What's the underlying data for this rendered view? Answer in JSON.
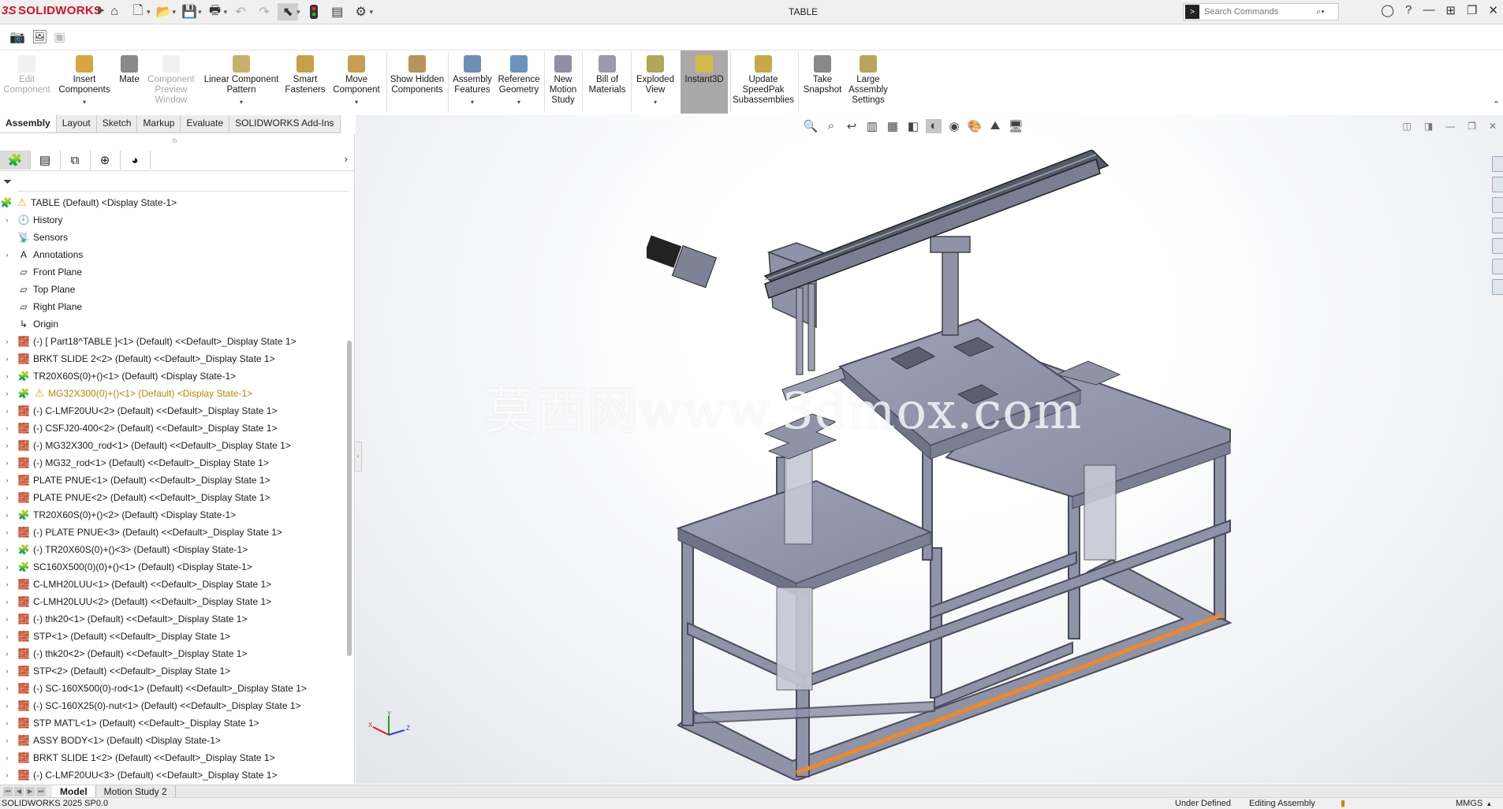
{
  "app": {
    "brand_prefix": "3S",
    "brand": "SOLIDWORKS",
    "doc_title": "TABLE"
  },
  "search": {
    "placeholder": "Search Commands"
  },
  "toolbar_icons": [
    "home-icon",
    "new-document-icon",
    "open-icon",
    "save-icon",
    "print-icon",
    "undo-icon",
    "redo-icon",
    "select-icon",
    "traffic-light-icon",
    "file-properties-icon",
    "options-gear-icon"
  ],
  "ribbon": {
    "buttons": [
      {
        "label": "Edit Component",
        "disabled": true
      },
      {
        "label": "Insert Components",
        "caret": true
      },
      {
        "label": "Mate"
      },
      {
        "label": "Component Preview Window",
        "disabled": true
      },
      {
        "label": "Linear Component Pattern",
        "caret": true
      },
      {
        "label": "Smart Fasteners"
      },
      {
        "label": "Move Component",
        "caret": true
      },
      {
        "label": "Show Hidden Components"
      },
      {
        "label": "Assembly Features",
        "caret": true
      },
      {
        "label": "Reference Geometry",
        "caret": true
      },
      {
        "label": "New Motion Study"
      },
      {
        "label": "Bill of Materials"
      },
      {
        "label": "Exploded View",
        "caret": true
      },
      {
        "label": "Instant3D",
        "active": true
      },
      {
        "label": "Update SpeedPak Subassemblies"
      },
      {
        "label": "Take Snapshot"
      },
      {
        "label": "Large Assembly Settings"
      }
    ]
  },
  "command_tabs": [
    "Assembly",
    "Layout",
    "Sketch",
    "Markup",
    "Evaluate",
    "SOLIDWORKS Add-Ins"
  ],
  "tree": {
    "root": "TABLE (Default) <Display State-1>",
    "items": [
      {
        "label": "History",
        "icon": "history-icon",
        "expandable": true
      },
      {
        "label": "Sensors",
        "icon": "sensors-icon"
      },
      {
        "label": "Annotations",
        "icon": "annotations-icon",
        "expandable": true
      },
      {
        "label": "Front Plane",
        "icon": "plane-icon"
      },
      {
        "label": "Top Plane",
        "icon": "plane-icon"
      },
      {
        "label": "Right Plane",
        "icon": "plane-icon"
      },
      {
        "label": "Origin",
        "icon": "origin-icon"
      },
      {
        "label": "(-) [ Part18^TABLE ]<1> (Default) <<Default>_Display State 1>",
        "icon": "part-icon",
        "expandable": true
      },
      {
        "label": "BRKT SLIDE 2<2> (Default) <<Default>_Display State 1>",
        "icon": "part-icon",
        "expandable": true
      },
      {
        "label": "TR20X60S(0)+()<1> (Default) <Display State-1>",
        "icon": "assembly-icon",
        "expandable": true
      },
      {
        "label": "MG32X300(0)+()<1> (Default) <Display State-1>",
        "icon": "assembly-icon",
        "expandable": true,
        "warning": true
      },
      {
        "label": "(-) C-LMF20UU<2> (Default) <<Default>_Display State 1>",
        "icon": "part-icon",
        "expandable": true
      },
      {
        "label": "(-) CSFJ20-400<2> (Default) <<Default>_Display State 1>",
        "icon": "part-icon",
        "expandable": true
      },
      {
        "label": "(-) MG32X300_rod<1> (Default) <<Default>_Display State 1>",
        "icon": "part-icon",
        "expandable": true
      },
      {
        "label": "(-) MG32_rod<1> (Default) <<Default>_Display State 1>",
        "icon": "part-icon",
        "expandable": true
      },
      {
        "label": "PLATE PNUE<1> (Default) <<Default>_Display State 1>",
        "icon": "part-icon",
        "expandable": true
      },
      {
        "label": "PLATE PNUE<2> (Default) <<Default>_Display State 1>",
        "icon": "part-icon",
        "expandable": true
      },
      {
        "label": "TR20X60S(0)+()<2> (Default) <Display State-1>",
        "icon": "assembly-icon",
        "expandable": true
      },
      {
        "label": "(-) PLATE PNUE<3> (Default) <<Default>_Display State 1>",
        "icon": "part-icon",
        "expandable": true
      },
      {
        "label": "(-) TR20X60S(0)+()<3> (Default) <Display State-1>",
        "icon": "assembly-icon",
        "expandable": true
      },
      {
        "label": "SC160X500(0)(0)+()<1> (Default) <Display State-1>",
        "icon": "assembly-icon",
        "expandable": true
      },
      {
        "label": "C-LMH20LUU<1> (Default) <<Default>_Display State 1>",
        "icon": "part-icon",
        "expandable": true
      },
      {
        "label": "C-LMH20LUU<2> (Default) <<Default>_Display State 1>",
        "icon": "part-icon",
        "expandable": true
      },
      {
        "label": "(-) thk20<1> (Default) <<Default>_Display State 1>",
        "icon": "part-icon",
        "expandable": true
      },
      {
        "label": "STP<1> (Default) <<Default>_Display State 1>",
        "icon": "part-icon",
        "expandable": true
      },
      {
        "label": "(-) thk20<2> (Default) <<Default>_Display State 1>",
        "icon": "part-icon",
        "expandable": true
      },
      {
        "label": "STP<2> (Default) <<Default>_Display State 1>",
        "icon": "part-icon",
        "expandable": true
      },
      {
        "label": "(-) SC-160X500(0)-rod<1> (Default) <<Default>_Display State 1>",
        "icon": "part-icon",
        "expandable": true
      },
      {
        "label": "(-) SC-160X25(0)-nut<1> (Default) <<Default>_Display State 1>",
        "icon": "part-icon",
        "expandable": true
      },
      {
        "label": "STP MAT'L<1> (Default) <<Default>_Display State 1>",
        "icon": "part-icon",
        "expandable": true
      },
      {
        "label": "ASSY BODY<1> (Default) <Display State-1>",
        "icon": "part-icon",
        "expandable": true
      },
      {
        "label": "BRKT SLIDE 1<2> (Default) <<Default>_Display State 1>",
        "icon": "part-icon",
        "expandable": true
      },
      {
        "label": "(-) C-LMF20UU<3> (Default) <<Default>_Display State 1>",
        "icon": "part-icon",
        "expandable": true
      }
    ]
  },
  "bottom_tabs": [
    "Model",
    "Motion Study 2"
  ],
  "status": {
    "version": "SOLIDWORKS 2025 SP0.0",
    "definition": "Under Defined",
    "mode": "Editing Assembly",
    "units": "MMGS"
  },
  "watermark": "莫西网www.3dmox.com",
  "triad": {
    "x": "X",
    "y": "Y",
    "z": "Z"
  },
  "colors": {
    "brand_red": "#d3122a",
    "model_steel": "#8f93a8",
    "highlight_edge": "#f08a24",
    "active_button": "#a9a9a9"
  }
}
